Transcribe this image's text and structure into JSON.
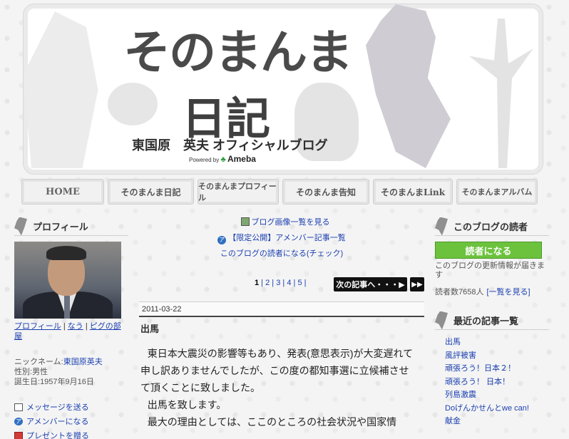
{
  "header": {
    "title_main": "そのまんま",
    "title_sub": "日記",
    "subtitle": "東国原　英夫 オフィシャルブログ",
    "powered_by": "Powered by",
    "brand": "Ameba"
  },
  "nav": {
    "tabs": [
      "HOME",
      "そのまんま日記",
      "そのまんまプロフィール",
      "そのまんま告知",
      "そのまんまLink",
      "そのまんまアルバム"
    ]
  },
  "left": {
    "heading": "プロフィール",
    "links": [
      "プロフィール",
      "なう",
      "ピグの部屋"
    ],
    "separator": " | ",
    "nickname_label": "ニックネーム:",
    "nickname": "東国原英夫",
    "gender_label": "性別:",
    "gender": "男性",
    "birthday_label": "誕生日:",
    "birthday": "1957年9月16日",
    "actions": [
      "メッセージを送る",
      "アメンバーになる",
      "プレゼントを贈る"
    ]
  },
  "center": {
    "link_images": "ブログ画像一覧を見る",
    "link_amember": "【限定公開】アメンバー記事一覧",
    "link_reader": "このブログの読者になる(チェック)",
    "pages": [
      "1",
      "2",
      "3",
      "4",
      "5"
    ],
    "next_button": "次の記事へ・・・▶",
    "last_button": "▶▶",
    "date": "2011-03-22",
    "post_title": "出馬",
    "post_paragraphs": [
      "東日本大震災の影響等もあり、発表(意思表示)が大変遅れて申し訳ありませんでしたが、この度の都知事選に立候補させて頂くことに致しました。",
      "出馬を致します。",
      "最大の理由としては、ここのところの社会状況や国家情"
    ]
  },
  "right": {
    "heading": "このブログの読者",
    "reader_button": "読者になる",
    "reader_desc": "このブログの更新情報が届きます",
    "reader_count": "読者数7658人",
    "reader_list_link": "一覧を見る",
    "recent_heading": "最近の記事一覧",
    "recent": [
      "出馬",
      "風評被害",
      "頑張ろう！日本２！",
      "頑張ろう！ 日本！",
      "列島激震",
      "Doげんかせんとwe can!",
      "献金"
    ]
  }
}
